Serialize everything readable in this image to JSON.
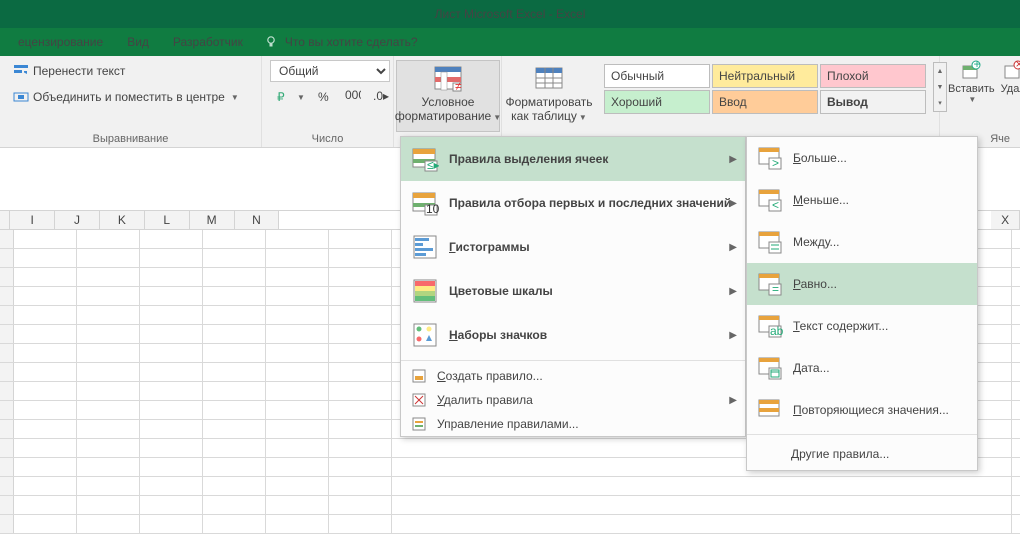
{
  "title": "Лист Microsoft Excel - Excel",
  "tabs": {
    "review": "ецензирование",
    "view": "Вид",
    "developer": "Разработчик",
    "tell": "Что вы хотите сделать?"
  },
  "align": {
    "wrap": "Перенести текст",
    "merge": "Объединить и поместить в центре",
    "label": "Выравнивание"
  },
  "number": {
    "format": "Общий",
    "label": "Число"
  },
  "bigbtns": {
    "cf": "Условное",
    "cf2": "форматирование",
    "fat": "Форматировать",
    "fat2": "как таблицу"
  },
  "styles": {
    "normal": "Обычный",
    "neutral": "Нейтральный",
    "bad": "Плохой",
    "good": "Хороший",
    "input": "Ввод",
    "output": "Вывод"
  },
  "cells": {
    "insert": "Вставить",
    "delete": "Удал",
    "label": "Яче"
  },
  "cols": [
    "I",
    "J",
    "K",
    "L",
    "M",
    "N",
    "",
    "",
    "",
    "",
    "",
    "",
    "",
    "",
    "",
    "X"
  ],
  "menu1": {
    "highlight": "Правила выделения ячеек",
    "toprules": "Правила отбора первых и последних значений",
    "databars": "Гистограммы",
    "colorscales": "Цветовые шкалы",
    "iconsets": "Наборы значков",
    "newrule": "Создать правило...",
    "clear": "Удалить правила",
    "manage": "Управление правилами..."
  },
  "menu2": {
    "greater": "Больше...",
    "less": "Меньше...",
    "between": "Между...",
    "equal": "Равно...",
    "textcontains": "Текст содержит...",
    "date": "Дата...",
    "duplicate": "Повторяющиеся значения...",
    "other": "Другие правила..."
  }
}
